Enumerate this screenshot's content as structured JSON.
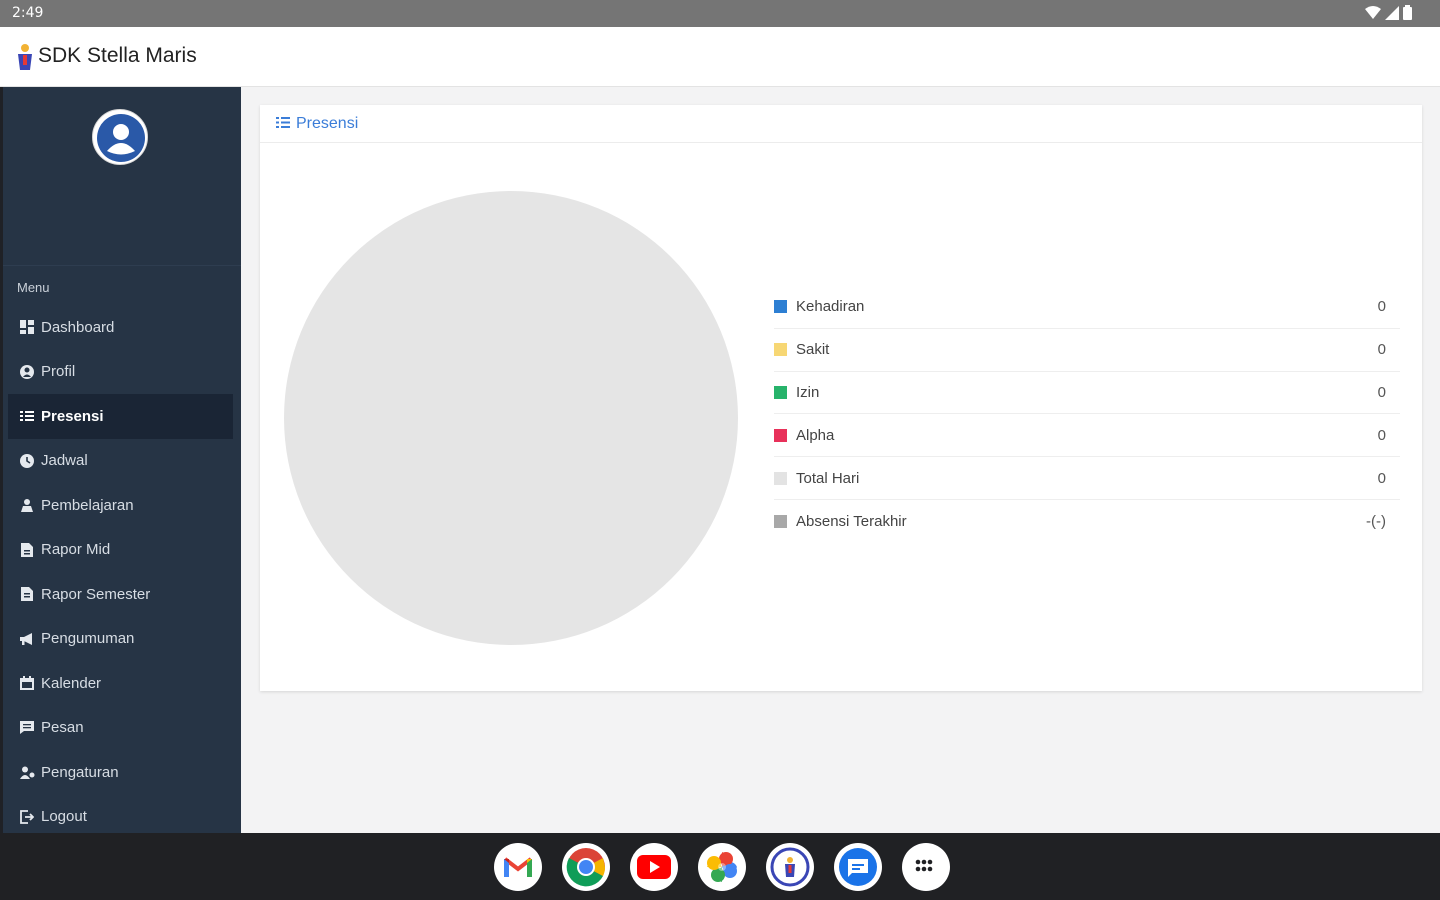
{
  "status_bar": {
    "time": "2:49"
  },
  "app": {
    "title": "SDK Stella Maris"
  },
  "sidebar": {
    "menu_label": "Menu",
    "items": [
      {
        "label": "Dashboard",
        "icon": "dashboard-icon"
      },
      {
        "label": "Profil",
        "icon": "user-circle-icon"
      },
      {
        "label": "Presensi",
        "icon": "list-check-icon",
        "active": true
      },
      {
        "label": "Jadwal",
        "icon": "clock-icon"
      },
      {
        "label": "Pembelajaran",
        "icon": "teacher-icon"
      },
      {
        "label": "Rapor Mid",
        "icon": "file-icon"
      },
      {
        "label": "Rapor Semester",
        "icon": "file-alt-icon"
      },
      {
        "label": "Pengumuman",
        "icon": "bullhorn-icon"
      },
      {
        "label": "Kalender",
        "icon": "calendar-icon"
      },
      {
        "label": "Pesan",
        "icon": "message-icon"
      },
      {
        "label": "Pengaturan",
        "icon": "users-cog-icon"
      },
      {
        "label": "Logout",
        "icon": "logout-icon"
      }
    ]
  },
  "card": {
    "title": "Presensi",
    "legend": [
      {
        "label": "Kehadiran",
        "value": "0",
        "color": "#2d7fd3"
      },
      {
        "label": "Sakit",
        "value": "0",
        "color": "#f7d774"
      },
      {
        "label": "Izin",
        "value": "0",
        "color": "#27b36b"
      },
      {
        "label": "Alpha",
        "value": "0",
        "color": "#e8315a"
      },
      {
        "label": "Total Hari",
        "value": "0",
        "color": "#e3e3e3"
      },
      {
        "label": "Absensi Terakhir",
        "value": "-(-)",
        "color": "#a8a8a8"
      }
    ]
  },
  "taskbar": {
    "apps": [
      "gmail-icon",
      "chrome-icon",
      "youtube-icon",
      "photos-icon",
      "stella-maris-app-icon",
      "messages-icon",
      "app-launcher-icon"
    ]
  }
}
